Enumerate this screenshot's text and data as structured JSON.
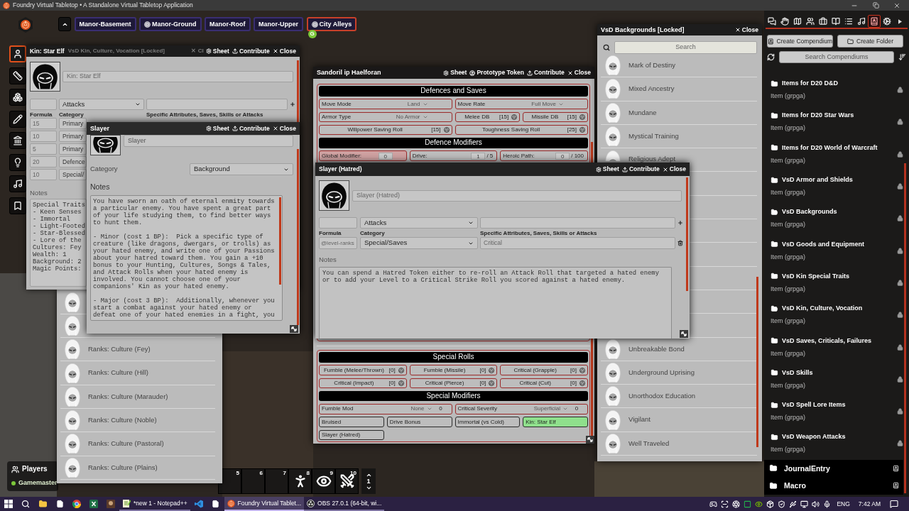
{
  "app_window": {
    "title": "Foundry Virtual Tabletop • A Standalone Virtual Tabletop Application"
  },
  "scene_navigation": [
    {
      "name": "Manor-Basement",
      "selected": false,
      "marked": false
    },
    {
      "name": "Manor-Ground",
      "selected": false,
      "marked": true
    },
    {
      "name": "Manor-Roof",
      "selected": false,
      "marked": false
    },
    {
      "name": "Manor-Upper",
      "selected": false,
      "marked": false
    },
    {
      "name": "City Alleys",
      "selected": true,
      "marked": true,
      "users": [
        {
          "initial": "G",
          "color": "#7cc83a"
        }
      ]
    }
  ],
  "scene_controls": [
    {
      "kind": "token",
      "selected": true
    },
    {
      "kind": "measure",
      "selected": false
    },
    {
      "kind": "tiles",
      "selected": false
    },
    {
      "kind": "drawings",
      "selected": false
    },
    {
      "kind": "walls",
      "selected": false
    },
    {
      "kind": "lighting",
      "selected": false
    },
    {
      "kind": "sounds",
      "selected": false
    },
    {
      "kind": "notes",
      "selected": false
    }
  ],
  "kin_window": {
    "title": "Kin: Star Elf",
    "ghost_title": "VsD Kin, Culture, Vocation [Locked]",
    "ghost_close": "✕ Cl",
    "header_buttons": [
      {
        "kind": "sheet",
        "label": "Sheet"
      },
      {
        "kind": "contribute",
        "label": "Contribute"
      },
      {
        "kind": "close",
        "label": "Close"
      }
    ],
    "name": "Kin: Star Elf",
    "new_entry": {
      "category": "Attacks"
    },
    "columns": [
      "Formula",
      "Category",
      "Specific Attributes, Saves, Skills or Attacks"
    ],
    "entries": [
      {
        "formula": "15",
        "category": "Primary"
      },
      {
        "formula": "10",
        "category": "Primary"
      },
      {
        "formula": "5",
        "category": "Primary"
      },
      {
        "formula": "20",
        "category": "Defence"
      },
      {
        "formula": "10",
        "category": "Special/"
      }
    ],
    "notes_label": "Notes",
    "notes": "Special Traits\n- Keen Senses\n- Immortal\n- Light-Footed\n- Star-Blessed\n- Lore of the\nCultures: Fey\nWealth: 1\nBackground: 2\nMagic Points:"
  },
  "rank_list_window": {
    "entries": [
      {
        "kind": "icon_only"
      },
      {
        "kind": "icon_only"
      },
      {
        "kind": "entry",
        "name": "Ranks: Culture (Fey)"
      },
      {
        "kind": "entry",
        "name": "Ranks: Culture (Hill)"
      },
      {
        "kind": "entry",
        "name": "Ranks: Culture (Marauder)"
      },
      {
        "kind": "entry",
        "name": "Ranks: Culture (Noble)"
      },
      {
        "kind": "entry",
        "name": "Ranks: Culture (Pastoral)"
      },
      {
        "kind": "entry",
        "name": "Ranks: Culture (Plains)"
      }
    ]
  },
  "slayer_window": {
    "title": "Slayer",
    "header_buttons": [
      {
        "kind": "sheet",
        "label": "Sheet"
      },
      {
        "kind": "contribute",
        "label": "Contribute"
      },
      {
        "kind": "close",
        "label": "Close"
      }
    ],
    "name": "Slayer",
    "category_label": "Category",
    "category": "Background",
    "notes_label": "Notes",
    "notes": "You have sworn an oath of eternal enmity towards a particular enemy. You have spent a great part of your life studying them, to find better ways to hunt them.\n\n- Minor (cost 1 BP):  Pick a specific type of creature (like dragons, dwergars, or trolls) as your hated enemy, and write one of your Passions about your hatred toward them. You gain a +10 bonus to your Hunting, Cultures, Songs & Tales, and Attack Rolls when your hated enemy is involved. You cannot choose one of your companions' Kin as your hated enemy.\n\n- Major (cost 3 BP):  Additionally, whenever you start a combat against your hated enemy or defeat one of your hated enemies in a fight, you"
  },
  "actor_sheet": {
    "title": "Sandoril ip Haelforan",
    "header_buttons": [
      {
        "kind": "sheet",
        "label": "Sheet"
      },
      {
        "kind": "token",
        "label": "Prototype Token"
      },
      {
        "kind": "contribute",
        "label": "Contribute"
      },
      {
        "kind": "close",
        "label": "Close"
      }
    ],
    "sections": [
      {
        "blocks": [
          {
            "kind": "heading",
            "text": "Defences and Saves"
          },
          {
            "kind": "row",
            "fields": [
              {
                "kind": "select",
                "label": "Move Mode",
                "value": "Land"
              },
              {
                "kind": "select",
                "label": "Move Rate",
                "value": "Full Move"
              }
            ]
          },
          {
            "kind": "row",
            "fields": [
              {
                "kind": "select",
                "label": "Armor Type",
                "value": "No Armor"
              },
              {
                "kind": "roll",
                "label": "Melee DB",
                "value": "[15]"
              },
              {
                "kind": "roll",
                "label": "Missile DB",
                "value": "[15]"
              }
            ]
          },
          {
            "kind": "row",
            "fields": [
              {
                "kind": "roll",
                "label": "Willpower Saving Roll",
                "value": "[15]"
              },
              {
                "kind": "roll",
                "label": "Toughness Saving Roll",
                "value": "[25]"
              }
            ]
          },
          {
            "kind": "heading",
            "text": "Defence Modifiers"
          },
          {
            "kind": "row",
            "fields": [
              {
                "kind": "counter",
                "label": "Global Modifier:",
                "value": "0",
                "highlighted": true
              },
              {
                "kind": "counter",
                "label": "Drive:",
                "value": "1",
                "max": "/ 5",
                "highlighted": false
              },
              {
                "kind": "counter",
                "label": "Heroic Path:",
                "value": "0",
                "max": "/ 100",
                "highlighted": false
              }
            ]
          }
        ]
      },
      {
        "blocks": [
          {
            "kind": "heading",
            "text": "Special Rolls"
          },
          {
            "kind": "row",
            "fields": [
              {
                "kind": "roll",
                "label": "Fumble (Melee/Thrown)",
                "value": "[0]"
              },
              {
                "kind": "roll",
                "label": "Fumble (Missile)",
                "value": "[0]"
              },
              {
                "kind": "roll",
                "label": "Critical (Grapple)",
                "value": "[0]"
              }
            ]
          },
          {
            "kind": "row",
            "fields": [
              {
                "kind": "roll",
                "label": "Critical (Impact)",
                "value": "[0]"
              },
              {
                "kind": "roll",
                "label": "Critical (Pierce)",
                "value": "[0]"
              },
              {
                "kind": "roll",
                "label": "Critical (Cut)",
                "value": "[0]"
              }
            ]
          },
          {
            "kind": "heading",
            "text": "Special Modifiers"
          },
          {
            "kind": "row",
            "fields": [
              {
                "kind": "select_number",
                "label": "Fumble Mod",
                "option": "None",
                "value": "0"
              },
              {
                "kind": "select_number",
                "label": "Critical Severity",
                "option": "Superficial",
                "value": "0"
              }
            ]
          },
          {
            "kind": "row",
            "fields": [
              {
                "kind": "effect",
                "label": "Bruised",
                "active": false
              },
              {
                "kind": "effect",
                "label": "Drive Bonus",
                "active": false
              },
              {
                "kind": "effect",
                "label": "Immortal (vs Cold)",
                "active": false
              },
              {
                "kind": "effect",
                "label": "Kin: Star Elf",
                "active": true
              }
            ]
          },
          {
            "kind": "row",
            "fields": [
              {
                "kind": "effect",
                "label": "Slayer (Hatred)",
                "active": false
              }
            ]
          }
        ]
      }
    ]
  },
  "backgrounds_window": {
    "title": "VsD Backgrounds [Locked]",
    "header_buttons": [
      {
        "kind": "close",
        "label": "Close"
      }
    ],
    "search_placeholder": "Search",
    "entries": [
      {
        "kind": "entry",
        "name": "Mark of Destiny"
      },
      {
        "kind": "entry",
        "name": "Mixed Ancestry"
      },
      {
        "kind": "entry",
        "name": "Mundane"
      },
      {
        "kind": "entry",
        "name": "Mystical Training"
      },
      {
        "kind": "cut_entry",
        "name": "Religious Adept"
      },
      {
        "kind": "covered"
      },
      {
        "kind": "covered"
      },
      {
        "kind": "covered"
      },
      {
        "kind": "covered"
      },
      {
        "kind": "covered"
      },
      {
        "kind": "covered"
      },
      {
        "kind": "covered"
      },
      {
        "kind": "entry",
        "name": "Unbreakable Bond"
      },
      {
        "kind": "entry",
        "name": "Underground Uprising"
      },
      {
        "kind": "entry",
        "name": "Unorthodox Education"
      },
      {
        "kind": "entry",
        "name": "Vigilant"
      },
      {
        "kind": "entry",
        "name": "Well Traveled"
      }
    ]
  },
  "hatred_window": {
    "title": "Slayer (Hatred)",
    "header_buttons": [
      {
        "kind": "sheet",
        "label": "Sheet"
      },
      {
        "kind": "contribute",
        "label": "Contribute"
      },
      {
        "kind": "close",
        "label": "Close"
      }
    ],
    "name": "Slayer (Hatred)",
    "new_entry": {
      "category": "Attacks"
    },
    "columns": [
      "Formula",
      "Category",
      "Specific Attributes, Saves, Skills or Attacks"
    ],
    "entries": [
      {
        "formula": "@level-ranks",
        "category": "Special/Saves",
        "target": "Critical"
      }
    ],
    "notes_label": "Notes",
    "notes": "You can spend a Hatred Token either to re-roll an Attack Roll that targeted a hated enemy or to add your Level to a Critical Strike Roll you scored against a hated enemy."
  },
  "players": {
    "title": "Players",
    "users": [
      {
        "name": "Gamemaster",
        "color": "#7cc83a"
      }
    ]
  },
  "hotbar": {
    "slots": [
      {
        "number": "5",
        "kind": "empty"
      },
      {
        "number": "6",
        "kind": "empty"
      },
      {
        "number": "7",
        "kind": "empty"
      },
      {
        "number": "8",
        "kind": "figure"
      },
      {
        "number": "9",
        "kind": "eye"
      },
      {
        "number": "10",
        "kind": "swords"
      }
    ],
    "page": "1"
  },
  "compendium_sidebar": {
    "tabs": [
      {
        "kind": "chat",
        "selected": false
      },
      {
        "kind": "combat",
        "selected": false
      },
      {
        "kind": "scenes",
        "selected": false
      },
      {
        "kind": "actors",
        "selected": false
      },
      {
        "kind": "items",
        "selected": false
      },
      {
        "kind": "journal",
        "selected": false
      },
      {
        "kind": "tables",
        "selected": false
      },
      {
        "kind": "playlists",
        "selected": false
      },
      {
        "kind": "compendium",
        "selected": true
      },
      {
        "kind": "settings",
        "selected": false
      },
      {
        "kind": "collapse",
        "selected": false
      }
    ],
    "buttons": [
      {
        "kind": "compendium",
        "label": "Create Compendium"
      },
      {
        "kind": "folder",
        "label": "Create Folder"
      }
    ],
    "search_placeholder": "Search Compendiums",
    "packs": [
      {
        "name": "Items for D20 D&D",
        "type": "Item (grpga)",
        "open": false,
        "locked": true
      },
      {
        "name": "Items for D20 Star Wars",
        "type": "Item (grpga)",
        "open": false,
        "locked": true
      },
      {
        "name": "Items for D20 World of Warcraft",
        "type": "Item (grpga)",
        "open": false,
        "locked": true
      },
      {
        "name": "VsD Armor and Shields",
        "type": "Item (grpga)",
        "open": false,
        "locked": true
      },
      {
        "name": "VsD Backgrounds",
        "type": "Item (grpga)",
        "open": true,
        "locked": true
      },
      {
        "name": "VsD Goods and Equipment",
        "type": "Item (grpga)",
        "open": false,
        "locked": true
      },
      {
        "name": "VsD Kin Special Traits",
        "type": "Item (grpga)",
        "open": false,
        "locked": true
      },
      {
        "name": "VsD Kin, Culture, Vocation",
        "type": "Item (grpga)",
        "open": true,
        "locked": true
      },
      {
        "name": "VsD Saves, Criticals, Failures",
        "type": "Item (grpga)",
        "open": false,
        "locked": true
      },
      {
        "name": "VsD Skills",
        "type": "Item (grpga)",
        "open": false,
        "locked": true
      },
      {
        "name": "VsD Spell Lore Items",
        "type": "Item (grpga)",
        "open": false,
        "locked": true
      },
      {
        "name": "VsD Weapon Attacks",
        "type": "Item (grpga)",
        "open": false,
        "locked": true
      }
    ],
    "folders": [
      {
        "name": "JournalEntry"
      },
      {
        "name": "Macro"
      }
    ]
  },
  "taskbar": {
    "apps": [
      {
        "kind": "start",
        "selected": false
      },
      {
        "kind": "search",
        "selected": false
      },
      {
        "kind": "explorer",
        "selected": false
      },
      {
        "kind": "file",
        "selected": false
      },
      {
        "kind": "chrome",
        "selected": false
      },
      {
        "kind": "excel",
        "selected": false
      },
      {
        "kind": "game",
        "selected": false
      },
      {
        "kind": "notepad",
        "label": "*new 1 - Notepad++",
        "selected": false
      },
      {
        "kind": "vscode",
        "selected": false
      },
      {
        "kind": "file",
        "selected": false
      },
      {
        "kind": "foundry",
        "label": "Foundry Virtual Tablet...",
        "selected": true
      },
      {
        "kind": "obs",
        "label": "OBS 27.0.1 (64-bit, wi...",
        "selected": false
      }
    ],
    "tray": [
      {
        "kind": "discord"
      },
      {
        "kind": "capture"
      },
      {
        "kind": "obs"
      },
      {
        "kind": "display"
      },
      {
        "kind": "nvidia"
      },
      {
        "kind": "dropbox"
      },
      {
        "kind": "security"
      },
      {
        "kind": "usb"
      },
      {
        "kind": "network"
      },
      {
        "kind": "volume"
      },
      {
        "kind": "mic"
      }
    ],
    "language": "ENG",
    "time": "7:42 AM"
  }
}
